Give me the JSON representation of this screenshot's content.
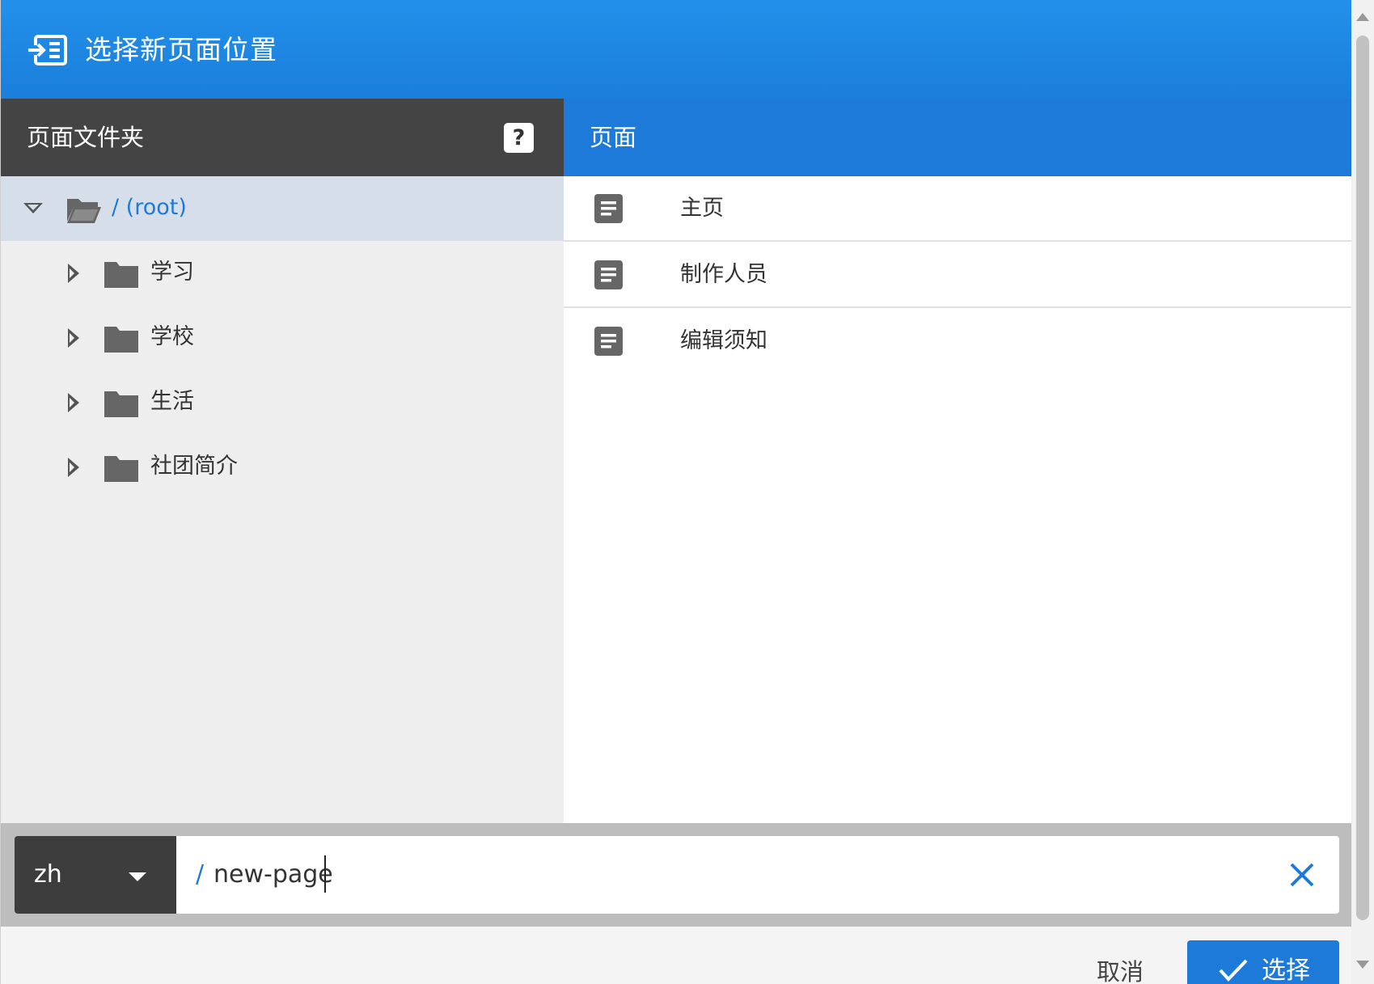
{
  "dialog": {
    "title": "选择新页面位置",
    "title_icon": "move-to-icon",
    "accent_color": "#1e7ad8"
  },
  "folders": {
    "header": "页面文件夹",
    "help_label": "?",
    "root": {
      "label": "/ (root)",
      "expanded": true,
      "selected": true
    },
    "items": [
      {
        "label": "学习"
      },
      {
        "label": "学校"
      },
      {
        "label": "生活"
      },
      {
        "label": "社团简介"
      }
    ]
  },
  "pages": {
    "header": "页面",
    "items": [
      {
        "label": "主页"
      },
      {
        "label": "制作人员"
      },
      {
        "label": "编辑须知"
      }
    ]
  },
  "location": {
    "locale": "zh",
    "path_prefix": "/",
    "path_value": "new-page"
  },
  "actions": {
    "cancel_label": "取消",
    "select_label": "选择"
  }
}
